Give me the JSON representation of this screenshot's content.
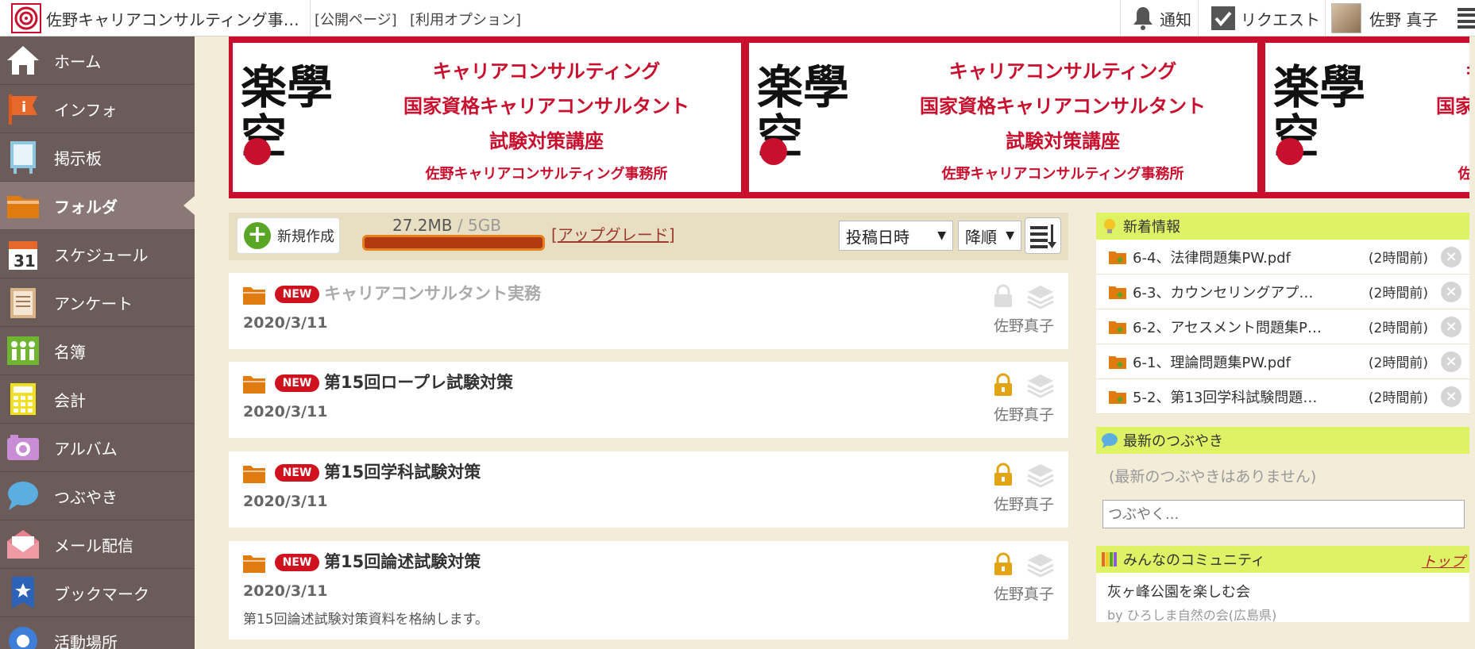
{
  "header": {
    "title": "佐野キャリアコンサルティング事…",
    "links": [
      "[公開ページ]",
      "[利用オプション]"
    ],
    "notify_label": "通知",
    "request_label": "リクエスト",
    "user_name": "佐野 真子"
  },
  "sidebar": {
    "items": [
      {
        "label": "ホーム",
        "icon": "home-icon"
      },
      {
        "label": "インフォ",
        "icon": "info-flag-icon"
      },
      {
        "label": "掲示板",
        "icon": "board-icon"
      },
      {
        "label": "フォルダ",
        "icon": "folder-icon",
        "active": true
      },
      {
        "label": "スケジュール",
        "icon": "calendar-icon"
      },
      {
        "label": "アンケート",
        "icon": "survey-icon"
      },
      {
        "label": "名簿",
        "icon": "members-icon"
      },
      {
        "label": "会計",
        "icon": "calculator-icon"
      },
      {
        "label": "アルバム",
        "icon": "camera-icon"
      },
      {
        "label": "つぶやき",
        "icon": "speech-bubble-icon"
      },
      {
        "label": "メール配信",
        "icon": "mail-icon"
      },
      {
        "label": "ブックマーク",
        "icon": "bookmark-star-icon"
      },
      {
        "label": "活動場所",
        "icon": "location-icon"
      }
    ]
  },
  "banner": {
    "mark": "楽學空",
    "line1": "キャリアコンサルティング",
    "line2": "国家資格キャリアコンサルタント",
    "line3": "試験対策講座",
    "line4": "佐野キャリアコンサルティング事務所"
  },
  "toolbar": {
    "new_label": "新規作成",
    "usage_used": "27.2MB",
    "usage_total": " / 5GB",
    "usage_fraction": 0.0053,
    "upgrade_label": "アップグレード",
    "sort_field": "投稿日時",
    "sort_order": "降順"
  },
  "folders": [
    {
      "badge": "NEW",
      "title": "キャリアコンサルタント実務",
      "date": "2020/3/11",
      "author": "佐野真子",
      "locked": false,
      "desc": ""
    },
    {
      "badge": "NEW",
      "title": "第15回ロープレ試験対策",
      "date": "2020/3/11",
      "author": "佐野真子",
      "locked": true,
      "desc": ""
    },
    {
      "badge": "NEW",
      "title": "第15回学科試験対策",
      "date": "2020/3/11",
      "author": "佐野真子",
      "locked": true,
      "desc": ""
    },
    {
      "badge": "NEW",
      "title": "第15回論述試験対策",
      "date": "2020/3/11",
      "author": "佐野真子",
      "locked": true,
      "desc": "第15回論述試験対策資料を格納します。"
    }
  ],
  "news": {
    "heading": "新着情報",
    "items": [
      {
        "title": "6-4、法律問題集PW.pdf",
        "time": "(2時間前)"
      },
      {
        "title": "6-3、カウンセリングアプロ…",
        "time": "(2時間前)"
      },
      {
        "title": "6-2、アセスメント問題集PW.…",
        "time": "(2時間前)"
      },
      {
        "title": "6-1、理論問題集PW.pdf",
        "time": "(2時間前)"
      },
      {
        "title": "5-2、第13回学科試験問題解…",
        "time": "(2時間前)"
      }
    ]
  },
  "tweets": {
    "heading": "最新のつぶやき",
    "empty": "(最新のつぶやきはありません)",
    "placeholder": "つぶやく..."
  },
  "community": {
    "heading": "みんなのコミュニティ",
    "top_link": "トップ",
    "items": [
      {
        "name": "灰ヶ峰公園を楽しむ会",
        "by": "by ひろしま自然の会(広島県)"
      }
    ]
  },
  "colors": {
    "brand_red": "#c8102e",
    "sidebar": "#6b5c5a",
    "accent_green": "#def266",
    "folder_orange": "#e07b10"
  }
}
